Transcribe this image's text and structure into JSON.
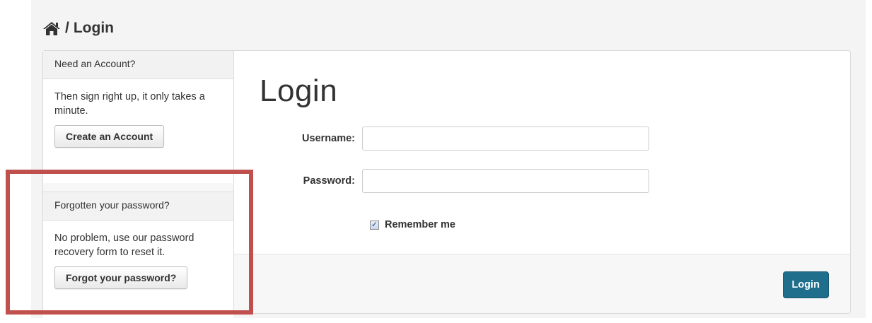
{
  "breadcrumb": {
    "home_icon": "home-icon",
    "separator": "/",
    "current": "Login"
  },
  "sidebar": {
    "signup": {
      "header": "Need an Account?",
      "text": "Then sign right up, it only takes a minute.",
      "button_label": "Create an Account"
    },
    "forgot": {
      "header": "Forgotten your password?",
      "text": "No problem, use our password recovery form to reset it.",
      "button_label": "Forgot your password?"
    }
  },
  "login_form": {
    "title": "Login",
    "username_label": "Username:",
    "username_value": "",
    "password_label": "Password:",
    "password_value": "",
    "remember_label": "Remember me",
    "remember_checked": true,
    "submit_label": "Login"
  },
  "colors": {
    "primary_button": "#1f6e8c",
    "highlight_box": "#c0504d"
  }
}
